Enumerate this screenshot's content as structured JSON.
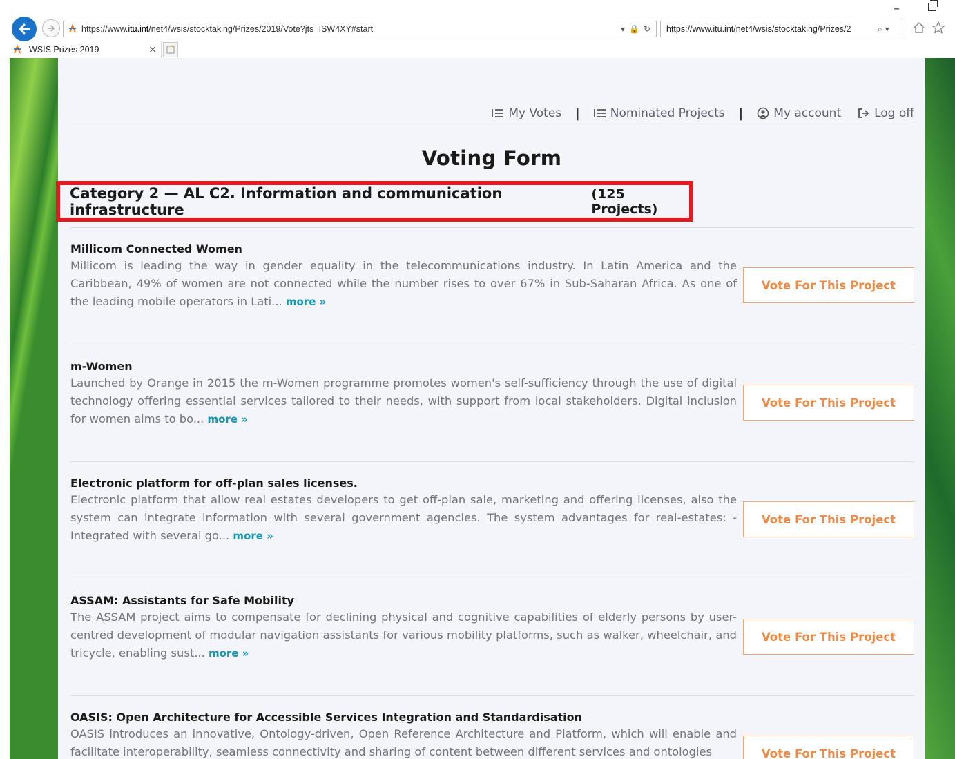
{
  "browser": {
    "address": "https://www.itu.int/net4/wsis/stocktaking/Prizes/2019/Vote?jts=ISW4XY#start",
    "address_prefix": "https://www.",
    "address_domain": "itu.int",
    "address_path": "/net4/wsis/stocktaking/Prizes/2019/Vote?jts=ISW4XY#start",
    "search_value": "https://www.itu.int/net4/wsis/stocktaking/Prizes/2",
    "tab_title": "WSIS Prizes 2019",
    "window_minimize": "–"
  },
  "nav": {
    "my_votes": "My Votes",
    "nominated_projects": "Nominated Projects",
    "my_account": "My account",
    "log_off": "Log off",
    "separator": "|"
  },
  "page": {
    "title": "Voting Form",
    "category_title": "Category 2 — AL C2. Information and communication infrastructure",
    "category_count": "(125 Projects)"
  },
  "projects": [
    {
      "title": "Millicom Connected Women",
      "description": "Millicom is leading the way in gender equality in the telecommunications industry. In Latin America and the Caribbean, 49% of women are not connected while the number rises to over 67% in Sub-Saharan Africa. As one of the leading mobile operators in Lati...",
      "more": "more »",
      "vote_label": "Vote For This Project"
    },
    {
      "title": "m-Women",
      "description": "Launched by Orange in 2015 the m-Women programme promotes women's self-sufficiency through the use of digital technology offering essential services tailored to their needs, with support from local stakeholders. Digital inclusion for women aims to bo...",
      "more": "more »",
      "vote_label": "Vote For This Project"
    },
    {
      "title": "Electronic platform for off-plan sales licenses.",
      "description": "Electronic platform that allow real estates developers to get off-plan sale, marketing and offering licenses, also the system can integrate information with several government agencies. The system advantages for real-estates: - Integrated with several go...",
      "more": "more »",
      "vote_label": "Vote For This Project"
    },
    {
      "title": "ASSAM: Assistants for Safe Mobility",
      "description": "The ASSAM project aims to compensate for declining physical and cognitive capabilities of elderly persons by user-centred development of modular navigation assistants for various mobility platforms, such as walker, wheelchair, and tricycle, enabling sust...",
      "more": "more »",
      "vote_label": "Vote For This Project"
    },
    {
      "title": "OASIS: Open Architecture for Accessible Services Integration and Standardisation",
      "description": "OASIS introduces an innovative, Ontology-driven, Open Reference Architecture and Platform, which will enable and facilitate interoperability, seamless connectivity and sharing of content between different services and ontologies",
      "more": "",
      "vote_label": "Vote For This Project"
    }
  ],
  "colors": {
    "accent_orange": "#f08a45",
    "link_teal": "#1597b5",
    "highlight_red": "#e21b23"
  }
}
